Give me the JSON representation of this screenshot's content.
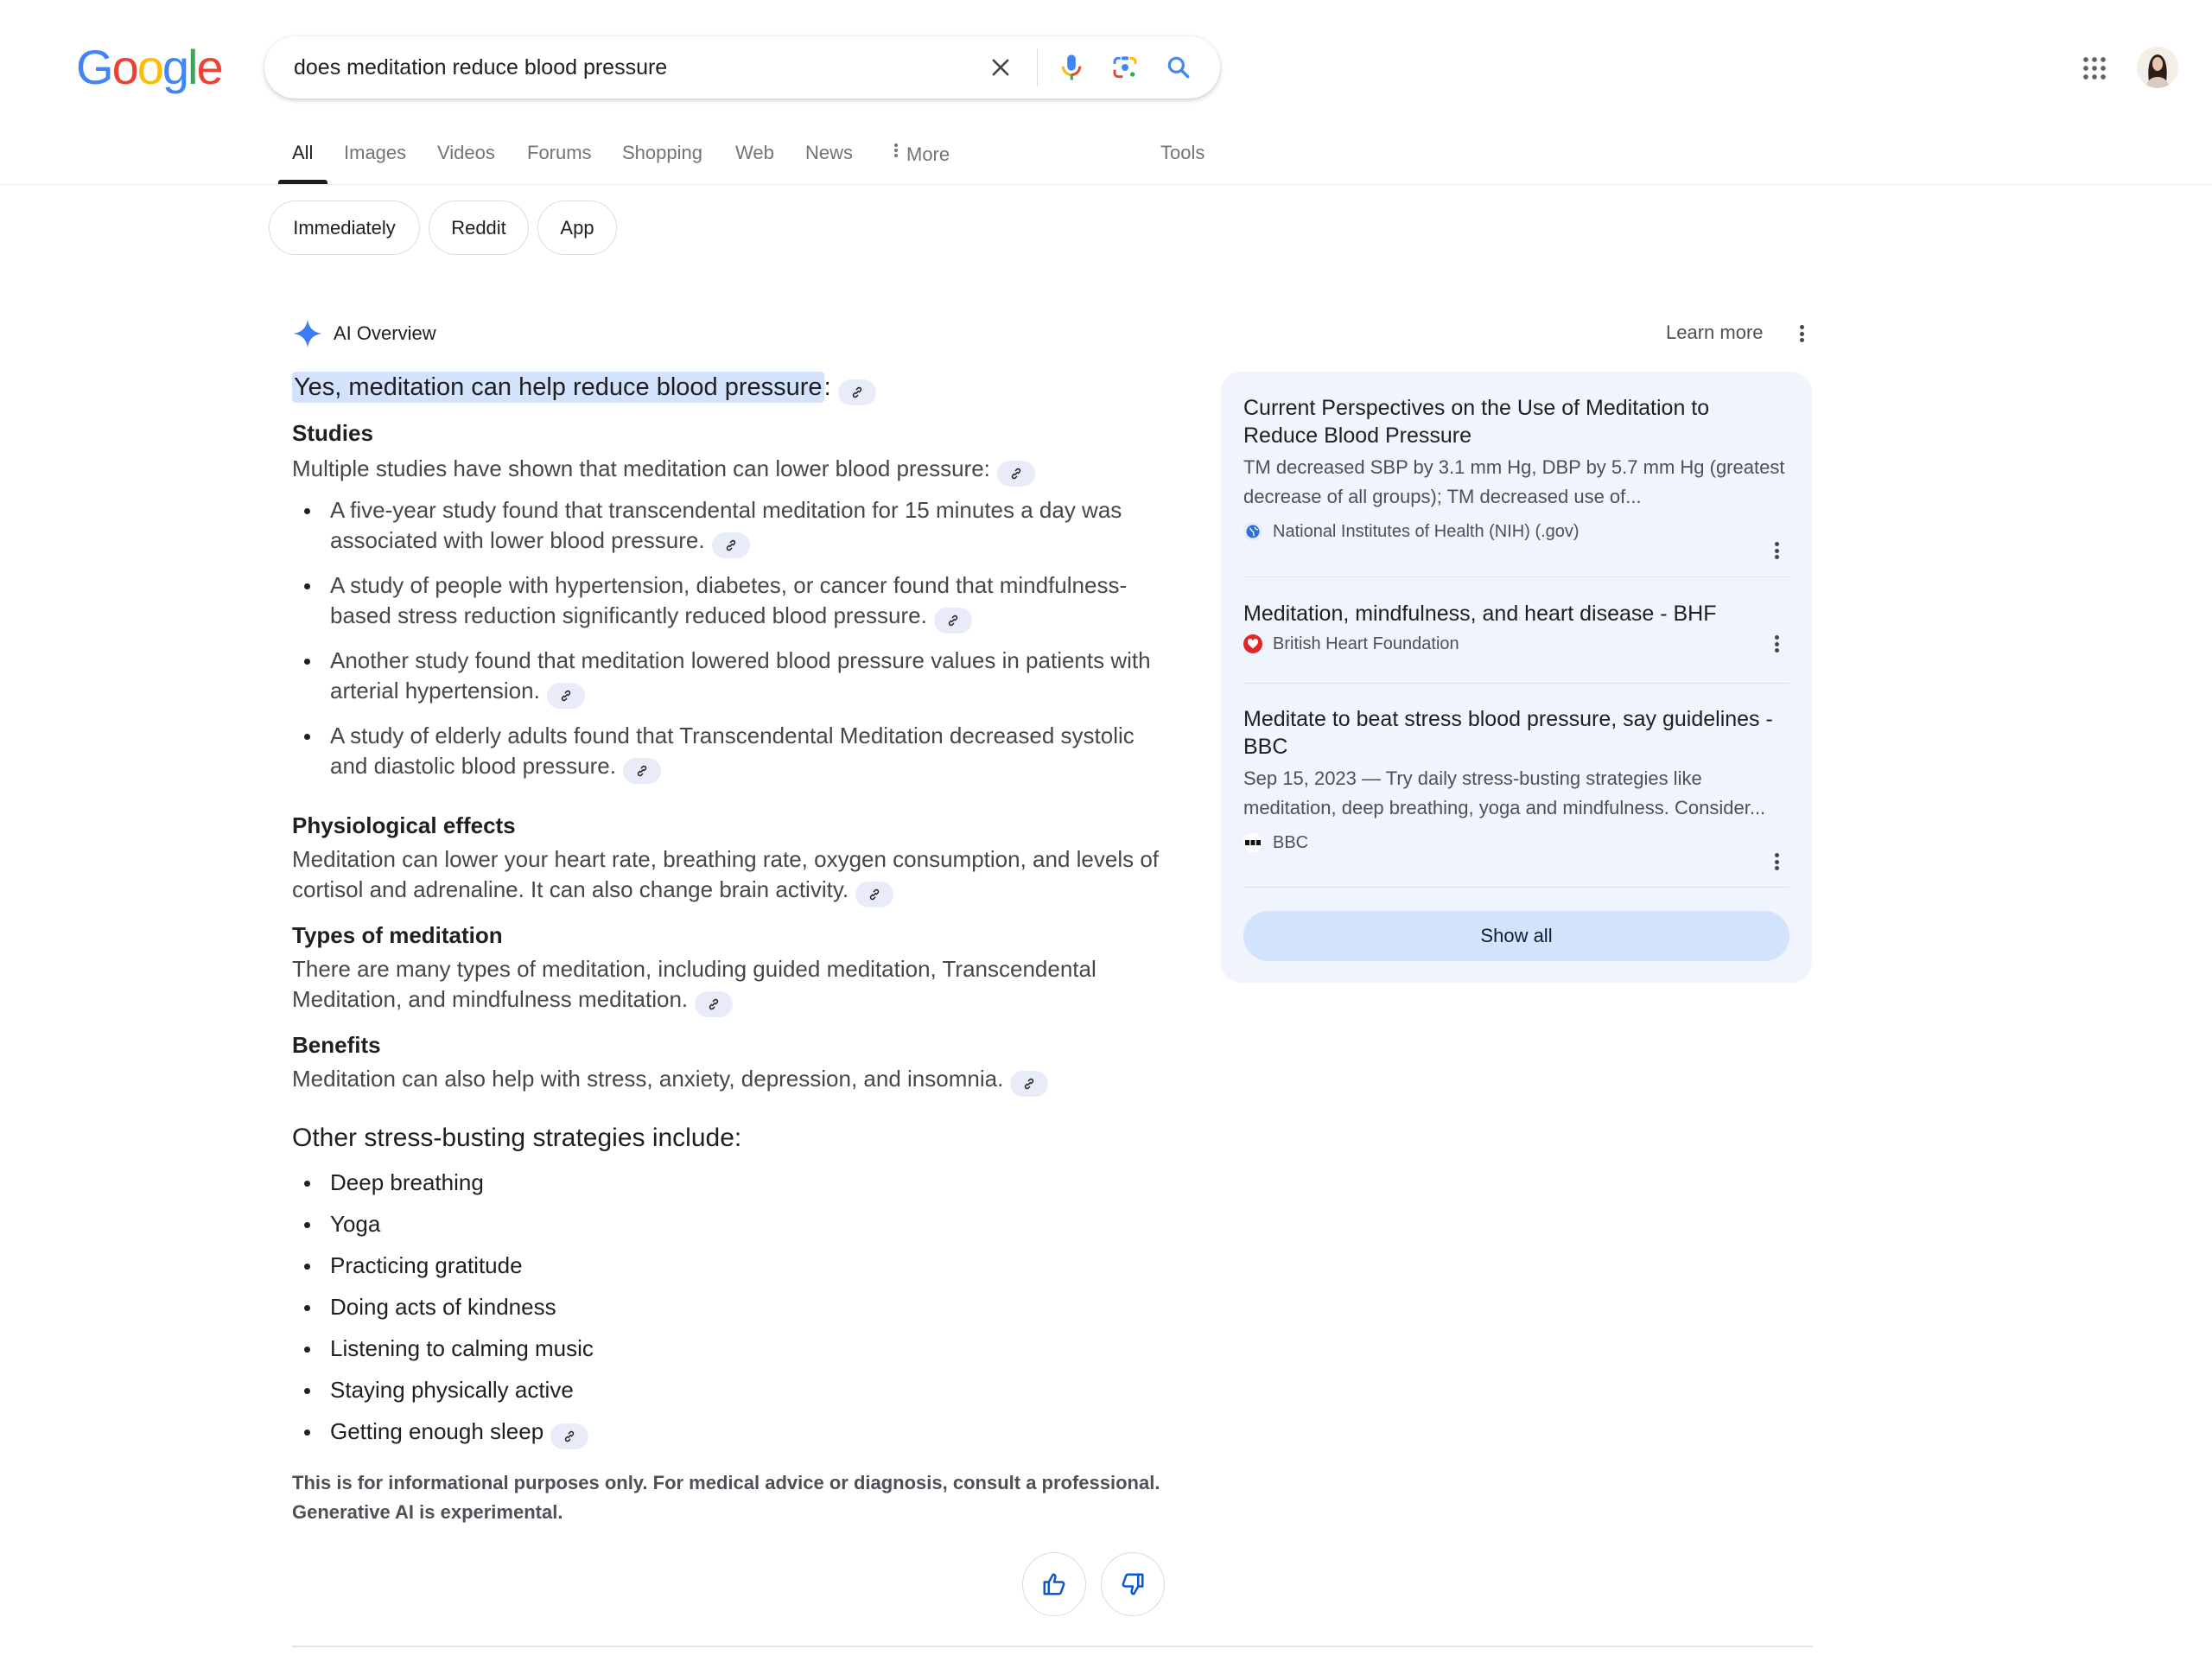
{
  "logo": {
    "letters": [
      "G",
      "o",
      "o",
      "g",
      "l",
      "e"
    ],
    "colors": [
      "#4285f4",
      "#ea4335",
      "#fbbc05",
      "#4285f4",
      "#34a853",
      "#ea4335"
    ]
  },
  "search": {
    "query": "does meditation reduce blood pressure",
    "icons": {
      "clear": "close-icon",
      "voice": "microphone-icon",
      "lens": "camera-lens-icon",
      "submit": "search-icon"
    }
  },
  "header": {
    "apps_icon": "apps-grid-icon",
    "avatar": "user-avatar"
  },
  "tabs": {
    "items": [
      {
        "label": "All",
        "active": true
      },
      {
        "label": "Images"
      },
      {
        "label": "Videos"
      },
      {
        "label": "Forums"
      },
      {
        "label": "Shopping"
      },
      {
        "label": "Web"
      },
      {
        "label": "News"
      },
      {
        "label": "More"
      }
    ],
    "tools": "Tools"
  },
  "chips": [
    "Immediately",
    "Reddit",
    "App"
  ],
  "ai_overview": {
    "title": "AI Overview",
    "learn_more": "Learn more",
    "headline": "Yes, meditation can help reduce blood pressure",
    "headline_suffix": ":",
    "sections": {
      "studies": {
        "title": "Studies",
        "intro": "Multiple studies have shown that meditation can lower blood pressure:",
        "bullets": [
          "A five-year study found that transcendental meditation for 15 minutes a day was associated with lower blood pressure.",
          "A study of people with hypertension, diabetes, or cancer found that mindfulness-based stress reduction significantly reduced blood pressure.",
          "Another study found that meditation lowered blood pressure values in patients with arterial hypertension.",
          "A study of elderly adults found that Transcendental Meditation decreased systolic and diastolic blood pressure."
        ]
      },
      "physiological": {
        "title": "Physiological effects",
        "text": "Meditation can lower your heart rate, breathing rate, oxygen consumption, and levels of cortisol and adrenaline. It can also change brain activity."
      },
      "types": {
        "title": "Types of meditation",
        "text": "There are many types of meditation, including guided meditation, Transcendental Meditation, and mindfulness meditation."
      },
      "benefits": {
        "title": "Benefits",
        "text": "Meditation can also help with stress, anxiety, depression, and insomnia."
      }
    },
    "strategies": {
      "title": "Other stress-busting strategies include:",
      "items": [
        "Deep breathing",
        "Yoga",
        "Practicing gratitude",
        "Doing acts of kindness",
        "Listening to calming music",
        "Staying physically active",
        "Getting enough sleep"
      ]
    },
    "disclaimer_line1": "This is for informational purposes only. For medical advice or diagnosis, consult a professional.",
    "disclaimer_line2": "Generative AI is experimental.",
    "feedback": {
      "up": "thumbs-up-icon",
      "down": "thumbs-down-icon"
    }
  },
  "sources": {
    "items": [
      {
        "title": "Current Perspectives on the Use of Meditation to Reduce Blood Pressure",
        "snippet": "TM decreased SBP by 3.1 mm Hg, DBP by 5.7 mm Hg (greatest decrease of all groups); TM decreased use of...",
        "site": "National Institutes of Health (NIH) (.gov)"
      },
      {
        "title": "Meditation, mindfulness, and heart disease - BHF",
        "site": "British Heart Foundation"
      },
      {
        "title": "Meditate to beat stress blood pressure, say guidelines - BBC",
        "snippet": "Sep 15, 2023 — Try daily stress-busting strategies like meditation, deep breathing, yoga and mindfulness. Consider...",
        "site": "BBC"
      }
    ],
    "show_all": "Show all"
  },
  "colors": {
    "accent_blue": "#1a73e8",
    "highlight": "#d3e3fd",
    "source_card_bg": "#f0f4fc",
    "link_chip_bg": "#e8ecf8"
  }
}
